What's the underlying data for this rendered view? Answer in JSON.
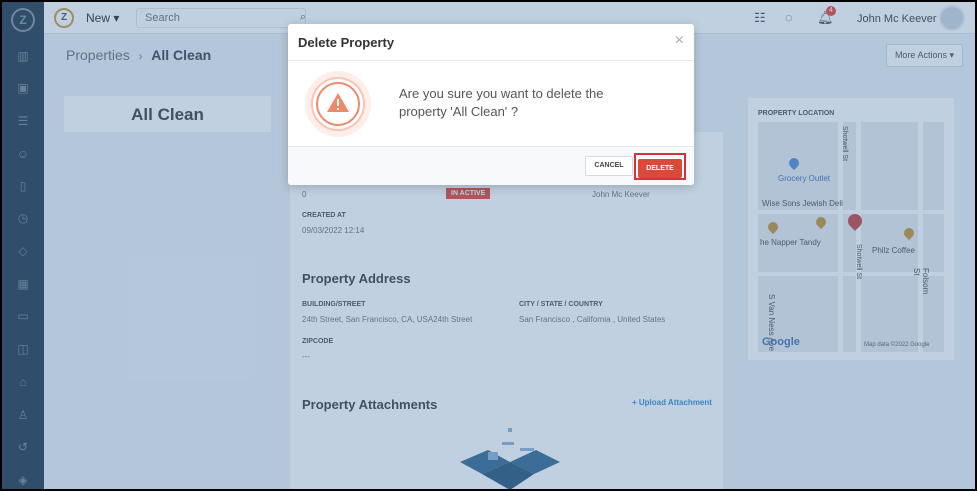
{
  "topbar": {
    "new_label": "New",
    "search_placeholder": "Search",
    "notification_count": "4",
    "user_name": "John Mc Keever"
  },
  "breadcrumb": {
    "parent": "Properties",
    "separator": "›",
    "current": "All Clean"
  },
  "more_actions": "More Actions",
  "left_card": {
    "title": "All Clean"
  },
  "details": {
    "row1_left_value": "0",
    "status_badge": "IN ACTIVE",
    "row1_right_value": "John Mc Keever",
    "created_at_label": "CREATED AT",
    "created_at_value": "09/03/2022 12:14"
  },
  "address": {
    "section_title": "Property Address",
    "building_label": "BUILDING/STREET",
    "building_value": "24th Street, San Francisco, CA, USA24th Street",
    "city_label": "CITY / STATE / COUNTRY",
    "city_value": "San Francisco , California , United States",
    "zip_label": "ZIPCODE",
    "zip_value": "---"
  },
  "attachments": {
    "section_title": "Property Attachments",
    "upload_label": "+ Upload Attachment"
  },
  "map": {
    "title": "PROPERTY LOCATION",
    "labels": [
      "Grocery Outlet",
      "Wise Sons Jewish Deli",
      "he Napper Tandy",
      "Philz Coffee",
      "S Van Ness Ave",
      "Folsom St",
      "Shotwell St",
      "Shotwell St"
    ],
    "google": "Google",
    "attribution": "Map data ©2022 Google"
  },
  "modal": {
    "title": "Delete Property",
    "close": "×",
    "message": "Are you sure you want to delete the property 'All Clean' ?",
    "cancel": "CANCEL",
    "delete": "DELETE"
  },
  "colors": {
    "danger": "#d94a3b",
    "sidebar": "#2c3e50",
    "warning": "#f0896a"
  }
}
